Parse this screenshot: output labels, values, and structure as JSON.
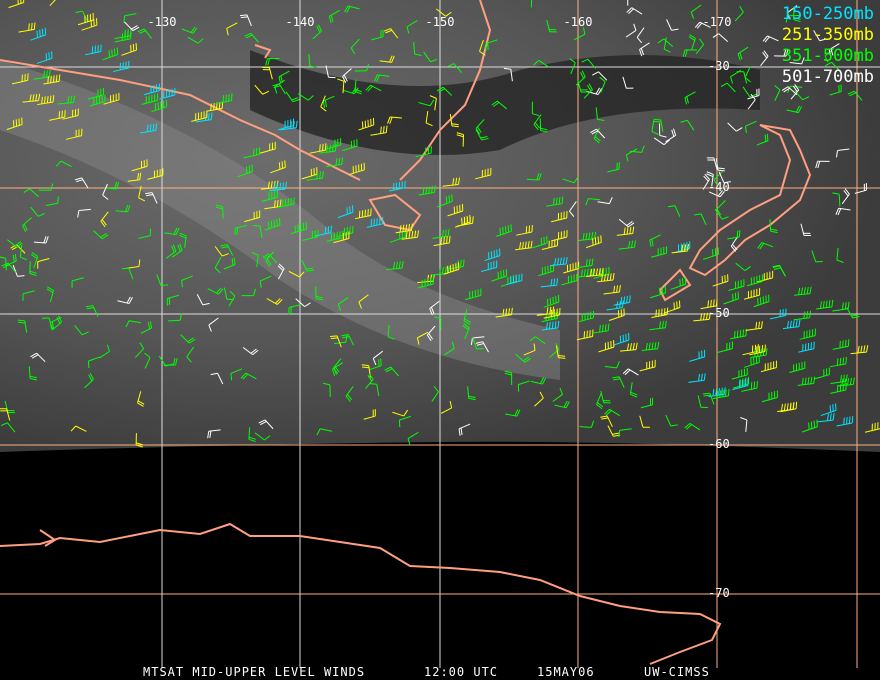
{
  "title": {
    "product": "MTSAT MID-UPPER LEVEL WINDS",
    "time": "12:00 UTC",
    "date": "15MAY06",
    "source": "UW-CIMSS"
  },
  "longitude_labels": [
    "-130",
    "-140",
    "-150",
    "-160",
    "-170"
  ],
  "latitude_labels": [
    "-30",
    "-40",
    "-50",
    "-60",
    "-70"
  ],
  "legend": [
    {
      "label": "150-250mb",
      "color": "#00e5ff"
    },
    {
      "label": "251-350mb",
      "color": "#ffff00"
    },
    {
      "label": "351-500mb",
      "color": "#00ff00"
    },
    {
      "label": "501-700mb",
      "color": "#ffffff"
    }
  ],
  "colors": {
    "grid": "#ffb080",
    "coast": "#ff9f80",
    "imagery_bg": "#5a5a5a",
    "space": "#000000"
  }
}
